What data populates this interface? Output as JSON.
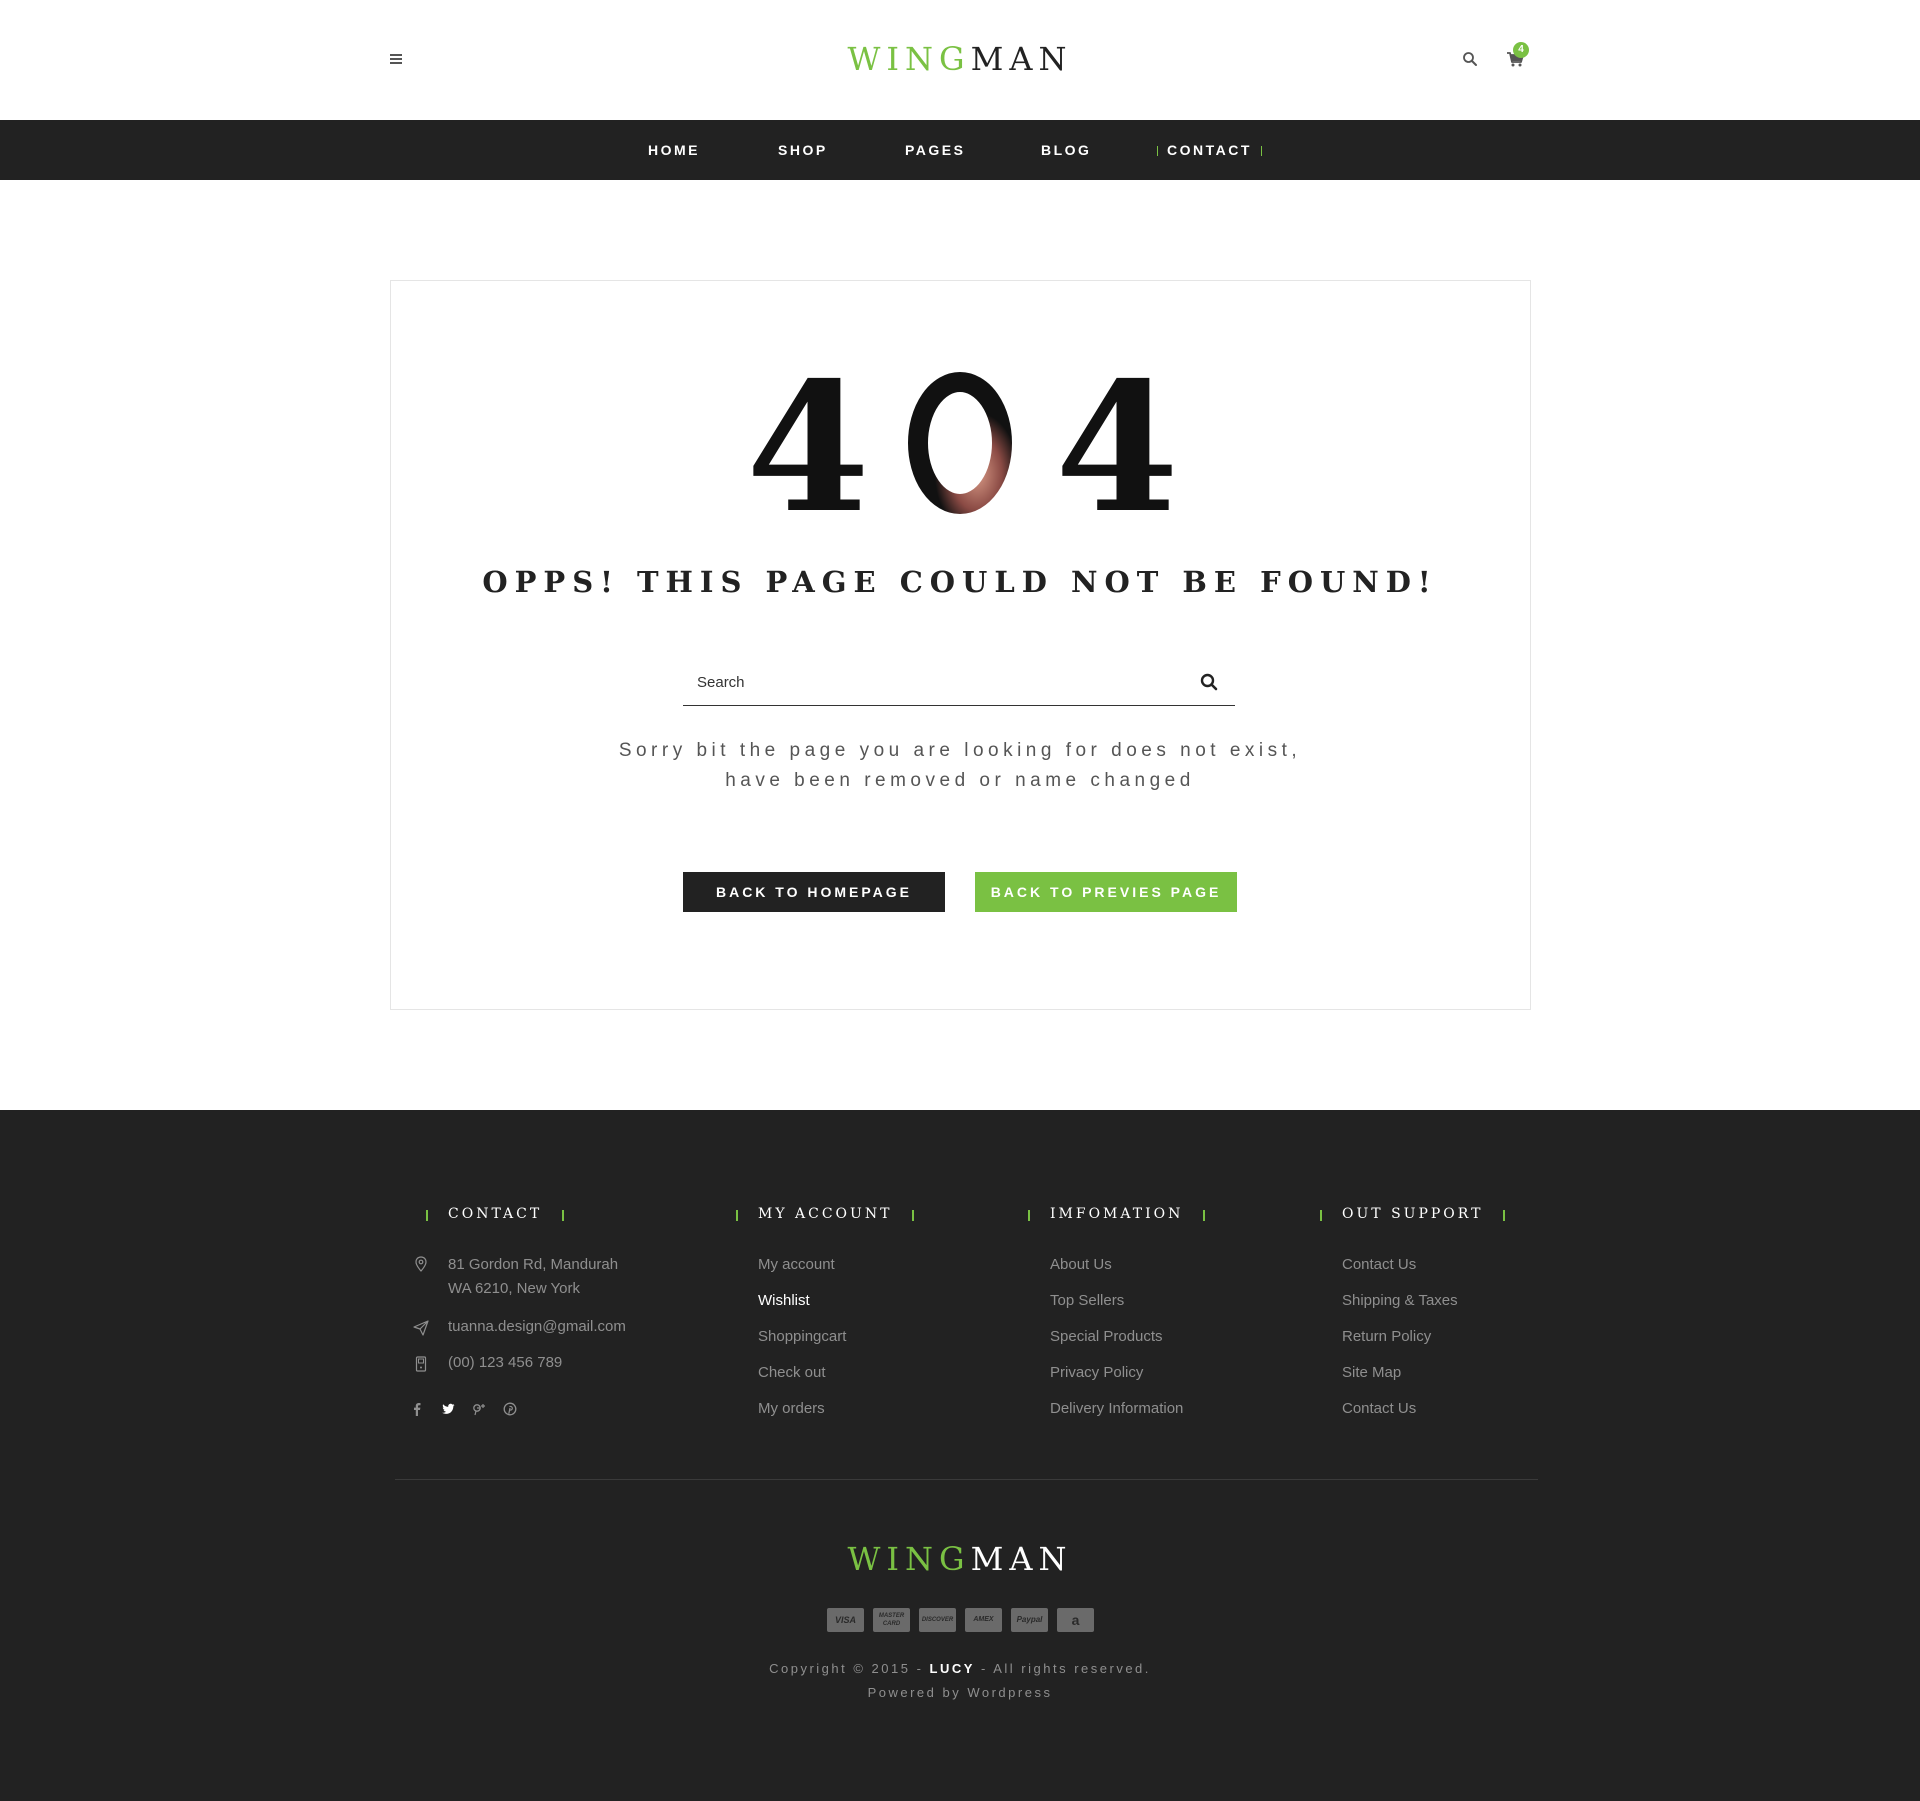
{
  "header": {
    "logo_accent": "WING",
    "logo_rest": "MAN",
    "cart_count": "4"
  },
  "nav": {
    "items": [
      {
        "label": "HOME"
      },
      {
        "label": "SHOP"
      },
      {
        "label": "PAGES"
      },
      {
        "label": "BLOG"
      },
      {
        "label": "CONTACT"
      }
    ],
    "active": "CONTACT"
  },
  "error": {
    "code_digits": [
      "4",
      "0",
      "4"
    ],
    "title": "OPPS! THIS PAGE COULD NOT BE FOUND!",
    "search_placeholder": "Search",
    "message_line1": "Sorry bit the page you are looking for does not exist,",
    "message_line2": "have been removed or name changed",
    "btn_home": "BACK TO HOMEPAGE",
    "btn_prev": "BACK TO PREVIES PAGE"
  },
  "footer": {
    "contact": {
      "heading": "CONTACT",
      "address_line1": "81 Gordon Rd, Mandurah",
      "address_line2": "WA 6210, New York",
      "email": "tuanna.design@gmail.com",
      "phone": "(00) 123 456 789"
    },
    "account": {
      "heading": "MY ACCOUNT",
      "links": [
        "My account",
        "Wishlist",
        "Shoppingcart",
        "Check out",
        "My orders"
      ],
      "highlighted": "Wishlist"
    },
    "information": {
      "heading": "IMFOMATION",
      "links": [
        "About Us",
        "Top Sellers",
        "Special Products",
        "Privacy Policy",
        "Delivery Information"
      ]
    },
    "support": {
      "heading": "OUT SUPPORT",
      "links": [
        "Contact Us",
        "Shipping & Taxes",
        "Return Policy",
        "Site Map",
        "Contact Us"
      ]
    },
    "logo_accent": "WING",
    "logo_rest": "MAN",
    "payments": [
      "VISA",
      "MASTER CARD",
      "DISCOVER",
      "AMEX",
      "Paypal",
      "a"
    ],
    "copyright_prefix": "Copyright © 2015 - ",
    "copyright_brand": "LUCY",
    "copyright_suffix": " - All rights reserved.",
    "powered": "Powered by Wordpress"
  },
  "colors": {
    "accent": "#7ac143",
    "dark": "#222222",
    "white": "#ffffff"
  },
  "icons": [
    "menu-icon",
    "search-icon",
    "cart-icon",
    "location-icon",
    "send-icon",
    "phone-icon",
    "facebook-icon",
    "twitter-icon",
    "google-plus-icon",
    "pinterest-icon"
  ]
}
